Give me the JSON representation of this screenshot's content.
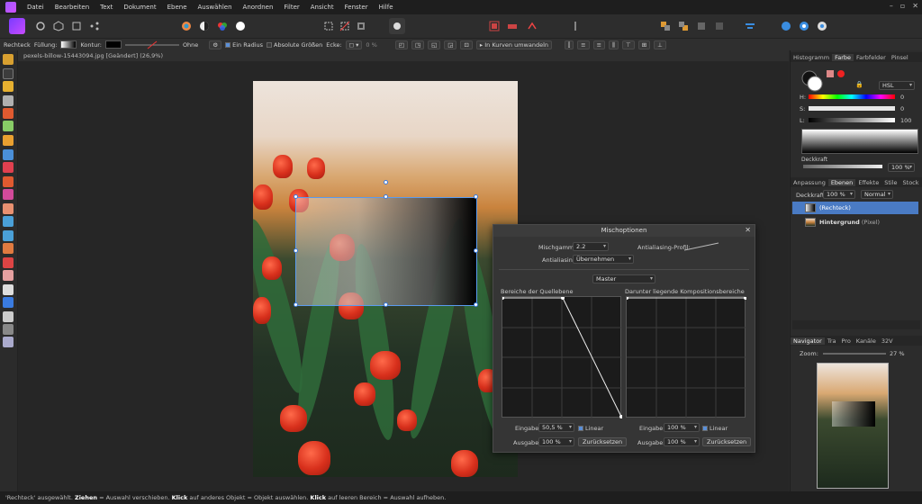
{
  "menu": [
    "Datei",
    "Bearbeiten",
    "Text",
    "Dokument",
    "Ebene",
    "Auswählen",
    "Anordnen",
    "Filter",
    "Ansicht",
    "Fenster",
    "Hilfe"
  ],
  "window_controls": [
    "–",
    "▫",
    "✕"
  ],
  "context": {
    "tool": "Rechteck",
    "fill_label": "Füllung:",
    "stroke_label": "Kontur:",
    "stroke_none": "Ohne",
    "radius_label": "Ein Radius",
    "absolute_sizes": "Absolute Größen",
    "corner_label": "Ecke:",
    "corner_value": "0 %",
    "convert_curves": "In Kurven umwandeln"
  },
  "document": {
    "tab_title": "pexels-billow-15443094.jpg [Geändert] (26,9%)"
  },
  "dialog": {
    "title": "Mischoptionen",
    "blend_gamma_label": "Mischgamma:",
    "blend_gamma_value": "2.2",
    "antialias_profile_label": "Antialiasing-Profil:",
    "antialias_label": "Antialiasing:",
    "antialias_value": "Übernehmen",
    "channel_value": "Master",
    "source_title": "Bereiche der Quellebene",
    "underlying_title": "Darunter liegende Kompositionsbereiche",
    "source_input_label": "Eingabe:",
    "source_input_value": "50,5 %",
    "source_output_label": "Ausgabe:",
    "source_output_value": "100 %",
    "under_input_label": "Eingabe:",
    "under_input_value": "100 %",
    "under_output_label": "Ausgabe:",
    "under_output_value": "100 %",
    "linear_label": "Linear",
    "reset_label": "Zurücksetzen"
  },
  "color_panel": {
    "tabs": [
      "Histogramm",
      "Farbe",
      "Farbfelder",
      "Pinsel"
    ],
    "active_tab": "Farbe",
    "model": "HSL",
    "h_label": "H:",
    "h_value": "0",
    "s_label": "S:",
    "s_value": "0",
    "l_label": "L:",
    "l_value": "100",
    "opacity_label": "Deckkraft",
    "opacity_value": "100 %"
  },
  "layers_panel": {
    "tabs": [
      "Anpassung",
      "Ebenen",
      "Effekte",
      "Stile",
      "Stock"
    ],
    "active_tab": "Ebenen",
    "opacity_label": "Deckkraft:",
    "opacity_value": "100 %",
    "blend_mode": "Normal",
    "layers": [
      {
        "name": "(Rechteck)",
        "selected": true
      },
      {
        "name": "Hintergrund",
        "type": "(Pixel)",
        "selected": false
      }
    ]
  },
  "navigator_panel": {
    "tabs": [
      "Navigator",
      "Tra",
      "Pro",
      "Kanäle",
      "32V"
    ],
    "active_tab": "Navigator",
    "zoom_label": "Zoom:",
    "zoom_value": "27 %"
  },
  "status": {
    "p1": "'Rechteck' ausgewählt.",
    "b1": "Ziehen",
    "p2": "= Auswahl verschieben.",
    "b2": "Klick",
    "p3": "auf anderes Objekt = Objekt auswählen.",
    "b3": "Klick",
    "p4": "auf leeren Bereich = Auswahl aufheben."
  }
}
